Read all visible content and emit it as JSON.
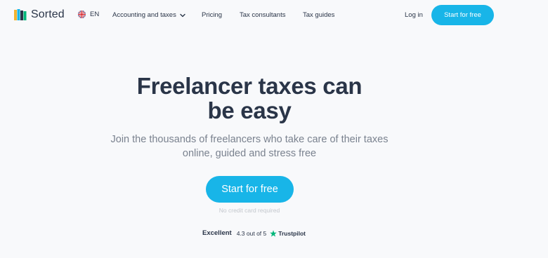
{
  "header": {
    "logo_text": "Sorted",
    "language": "EN",
    "nav": {
      "accounting": "Accounting and taxes",
      "pricing": "Pricing",
      "consultants": "Tax consultants",
      "guides": "Tax guides"
    },
    "login": "Log in",
    "cta": "Start for free"
  },
  "hero": {
    "title_line1": "Freelancer taxes can",
    "title_line2": "be easy",
    "subtitle_line1": "Join the thousands of freelancers who take care of their taxes",
    "subtitle_line2": "online, guided and stress free",
    "cta": "Start for free",
    "note": "No credit card required"
  },
  "trustpilot": {
    "rating_word": "Excellent",
    "score": "4.3 out of 5",
    "brand": "Trustpilot"
  },
  "colors": {
    "accent": "#18b5e8",
    "text": "#2a3548",
    "muted": "#7a828f",
    "background": "#f8f9fb",
    "trustpilot_green": "#00b67a"
  },
  "icons": [
    "sorted-logo-icon",
    "uk-flag-icon",
    "chevron-down-icon",
    "trustpilot-star-icon"
  ]
}
